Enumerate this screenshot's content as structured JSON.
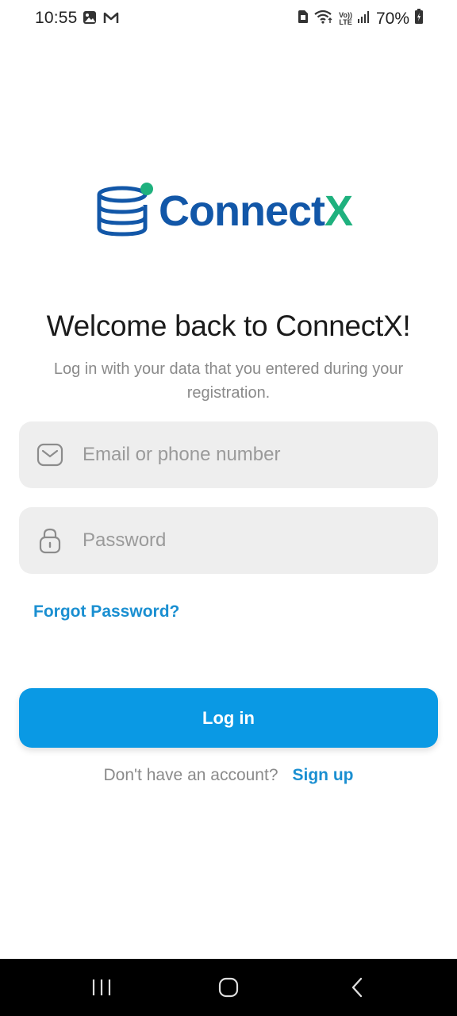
{
  "status_bar": {
    "time": "10:55",
    "battery_percent": "70%",
    "left_icons": [
      "gallery-icon",
      "gmail-icon"
    ],
    "right_icons": [
      "sim-icon",
      "wifi-icon",
      "volte-icon",
      "signal-icon",
      "battery-icon"
    ],
    "volte_label_top": "Vo))",
    "volte_label_bottom": "LTE"
  },
  "logo": {
    "text_main": "Connect",
    "text_accent": "X",
    "brand_color": "#1257a8",
    "accent_color": "#1fb17e"
  },
  "welcome": {
    "title": "Welcome back to ConnectX!",
    "subtitle": "Log in with your data that you entered during your registration."
  },
  "form": {
    "email": {
      "placeholder": "Email or phone number",
      "value": "",
      "icon": "mail-icon"
    },
    "password": {
      "placeholder": "Password",
      "value": "",
      "icon": "lock-icon"
    },
    "forgot_password": "Forgot Password?",
    "login_label": "Log in",
    "accent_color": "#0a99e4"
  },
  "signup": {
    "prompt": "Don't have an account?",
    "link_label": "Sign up"
  },
  "nav_bar": {
    "buttons": [
      "recents-icon",
      "home-icon",
      "back-icon"
    ]
  }
}
